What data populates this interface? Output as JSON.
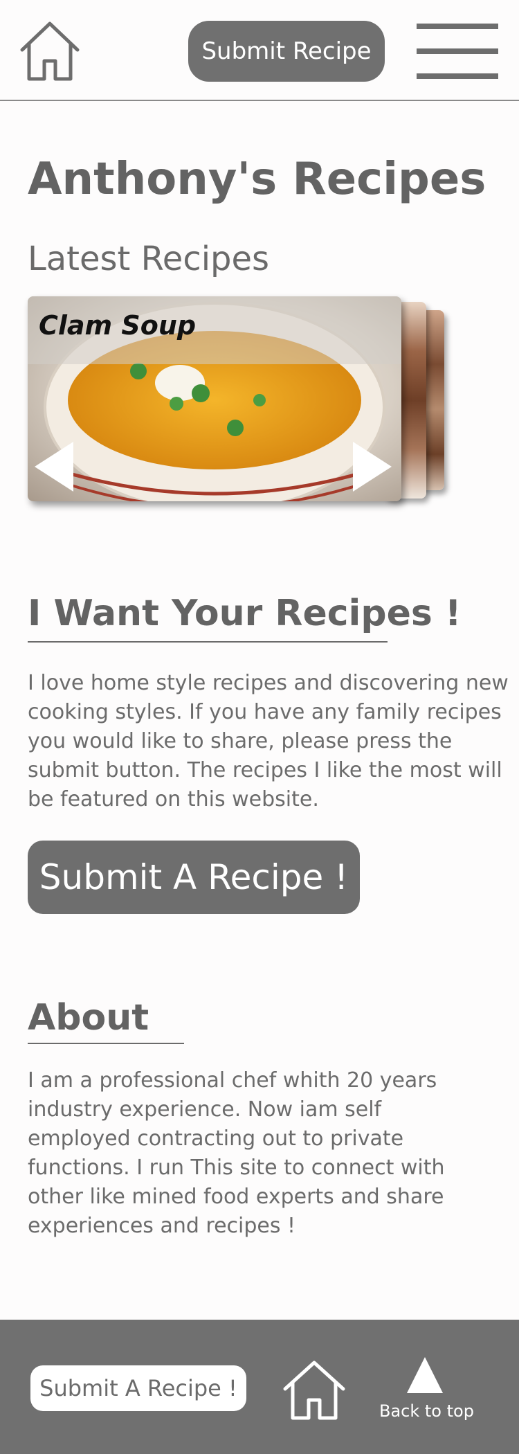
{
  "header": {
    "submit_label": "Submit Recipe"
  },
  "main": {
    "site_title": "Anthony's Recipes",
    "latest_heading": "Latest Recipes",
    "carousel": {
      "current_title": "Clam Soup"
    },
    "want_section": {
      "heading": "I Want Your Recipes !",
      "body": "I love home style recipes and discovering new cooking styles. If you have any family recipes you would like to share, please press the submit button. The recipes I like the most will be featured on this website.",
      "button_label": "Submit A Recipe !"
    },
    "about_section": {
      "heading": "About",
      "body": "I am a professional chef whith 20 years industry experience. Now iam self employed contracting out to private functions. I run This site to connect with other like mined food experts and share experiences and recipes !"
    }
  },
  "footer": {
    "submit_label": "Submit A Recipe !",
    "back_to_top_label": "Back to top"
  },
  "colors": {
    "primary_gray": "#707070",
    "text_gray": "#6b6b6b",
    "background": "#fdfcfc"
  }
}
